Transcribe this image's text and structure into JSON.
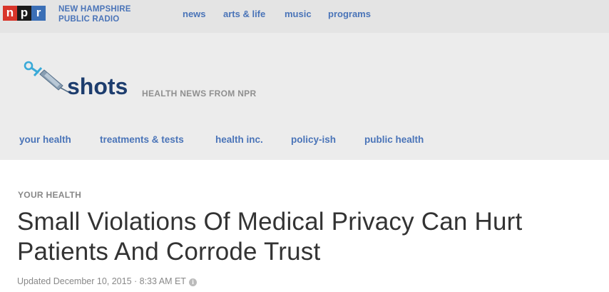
{
  "brand": {
    "logo_letters": [
      "n",
      "p",
      "r"
    ],
    "logo_colors": [
      "#d8352a",
      "#1a1a1a",
      "#3b6fb6"
    ],
    "station_line1": "NEW HAMPSHIRE",
    "station_line2": "PUBLIC RADIO"
  },
  "top_nav": [
    "news",
    "arts & life",
    "music",
    "programs"
  ],
  "blog": {
    "name": "shots",
    "icon": "syringe-icon",
    "tagline": "HEALTH NEWS FROM NPR"
  },
  "section_nav": [
    "your health",
    "treatments & tests",
    "health inc.",
    "policy-ish",
    "public health"
  ],
  "article": {
    "slug": "YOUR HEALTH",
    "headline_line1": "Small Violations Of Medical Privacy Can Hurt",
    "headline_line2": "Patients And Corrode Trust",
    "dateline": "Updated December 10, 2015 · 8:33 AM ET",
    "info_icon": "info-icon"
  },
  "colors": {
    "link_blue": "#4a74b8",
    "headline": "#333333",
    "topbar_bg": "#e4e4e4",
    "header_bg": "#ececec"
  }
}
